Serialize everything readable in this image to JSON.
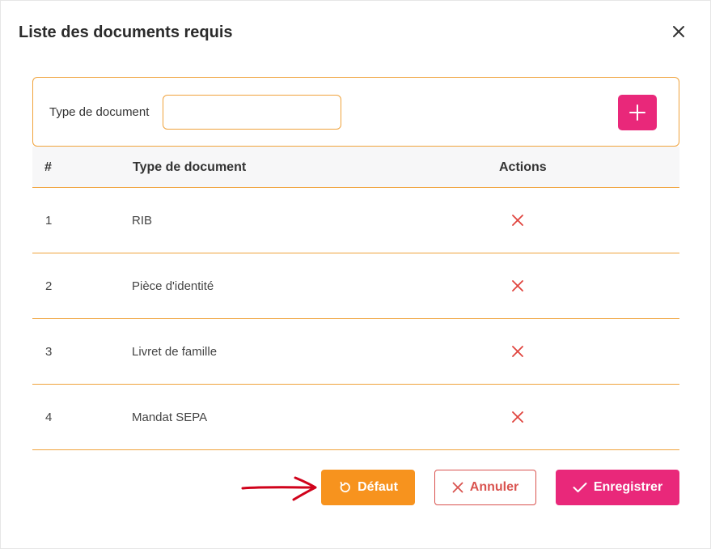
{
  "dialog": {
    "title": "Liste des documents requis"
  },
  "filter": {
    "label": "Type de document",
    "input_value": "",
    "placeholder": ""
  },
  "table": {
    "headers": [
      "#",
      "Type de document",
      "Actions"
    ],
    "rows": [
      {
        "index": "1",
        "type": "RIB"
      },
      {
        "index": "2",
        "type": "Pièce d'identité"
      },
      {
        "index": "3",
        "type": "Livret de famille"
      },
      {
        "index": "4",
        "type": "Mandat SEPA"
      }
    ]
  },
  "footer": {
    "default_label": "Défaut",
    "cancel_label": "Annuler",
    "save_label": "Enregistrer"
  },
  "colors": {
    "accent_orange": "#f7931e",
    "border_orange": "#f0a33c",
    "primary_pink": "#e9287a",
    "danger_red": "#d9534f",
    "annotation_arrow": "#d0021b"
  },
  "icons": [
    "close-icon",
    "plus-icon",
    "delete-x-icon",
    "reset-icon",
    "cancel-x-icon",
    "check-icon",
    "annotation-arrow"
  ]
}
